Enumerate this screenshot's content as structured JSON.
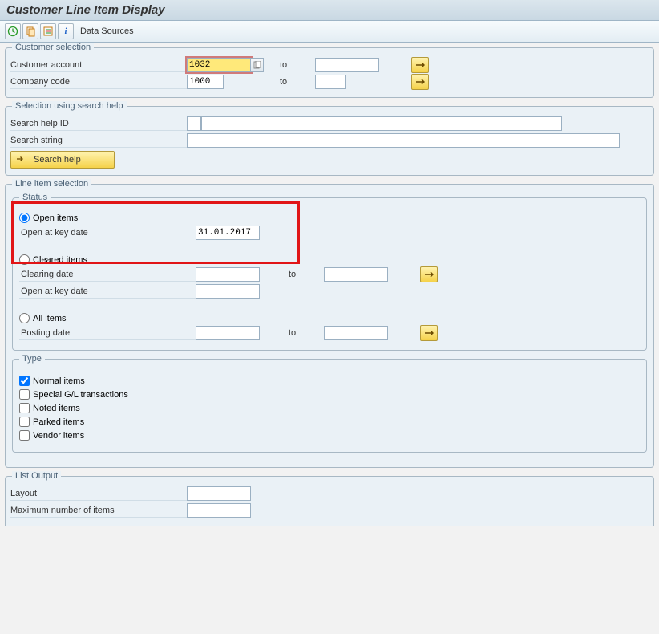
{
  "title": "Customer Line Item Display",
  "toolbar": {
    "data_sources": "Data Sources"
  },
  "customer_selection": {
    "title": "Customer selection",
    "account_label": "Customer account",
    "account_value": "1032",
    "to": "to",
    "code_label": "Company code",
    "code_value": "1000"
  },
  "search_help": {
    "title": "Selection using search help",
    "id_label": "Search help ID",
    "string_label": "Search string",
    "button": "Search help"
  },
  "line_item": {
    "title": "Line item selection",
    "status": {
      "title": "Status",
      "open_items": "Open items",
      "open_key_date_label": "Open at key date",
      "open_key_date_value": "31.01.2017",
      "cleared_items": "Cleared items",
      "clearing_date": "Clearing date",
      "open_key_date2": "Open at key date",
      "all_items": "All items",
      "posting_date": "Posting date",
      "to": "to"
    },
    "type": {
      "title": "Type",
      "normal": "Normal items",
      "special": "Special G/L transactions",
      "noted": "Noted items",
      "parked": "Parked items",
      "vendor": "Vendor items"
    }
  },
  "list_output": {
    "title": "List Output",
    "layout": "Layout",
    "max_items": "Maximum number of items"
  }
}
